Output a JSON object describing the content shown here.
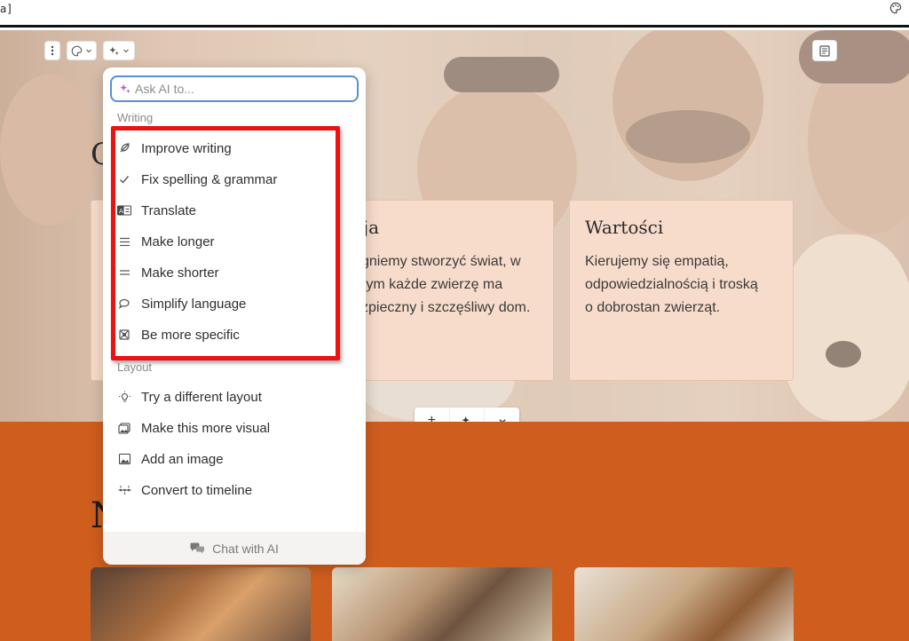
{
  "top_strip": {
    "fragment": "a]"
  },
  "hero": {
    "title_fragment": "C",
    "cards": [
      {
        "title": "izja",
        "text": [
          "gniemy stworzyć świat, w",
          "rym każde zwierzę ma",
          "zpieczny i szczęśliwy dom."
        ]
      },
      {
        "title": "Wartości",
        "text": [
          "Kierujemy się empatią,",
          "odpowiedzialnością i troską",
          "o dobrostan zwierząt."
        ]
      }
    ]
  },
  "insert_toolbar": {
    "add": "+",
    "ai": "✦",
    "more": "⌄"
  },
  "section2": {
    "title_fragment": "N"
  },
  "ai_menu": {
    "search_placeholder": "Ask AI to...",
    "groups": [
      {
        "label": "Writing",
        "items": [
          {
            "label": "Improve writing",
            "icon": "feather-icon"
          },
          {
            "label": "Fix spelling & grammar",
            "icon": "check-icon"
          },
          {
            "label": "Translate",
            "icon": "translate-icon"
          },
          {
            "label": "Make longer",
            "icon": "lines-longer-icon"
          },
          {
            "label": "Make shorter",
            "icon": "lines-shorter-icon"
          },
          {
            "label": "Simplify language",
            "icon": "speech-bubble-icon"
          },
          {
            "label": "Be more specific",
            "icon": "target-icon"
          }
        ]
      },
      {
        "label": "Layout",
        "items": [
          {
            "label": "Try a different layout",
            "icon": "lightbulb-icon"
          },
          {
            "label": "Make this more visual",
            "icon": "image-stack-icon"
          },
          {
            "label": "Add an image",
            "icon": "image-icon"
          },
          {
            "label": "Convert to timeline",
            "icon": "timeline-icon"
          }
        ]
      }
    ],
    "footer": "Chat with AI"
  },
  "colors": {
    "orange_section": "#cf5e1e",
    "card_bg": "#f8dccb",
    "highlight": "#ee1111",
    "focus": "#5b8fd6"
  }
}
